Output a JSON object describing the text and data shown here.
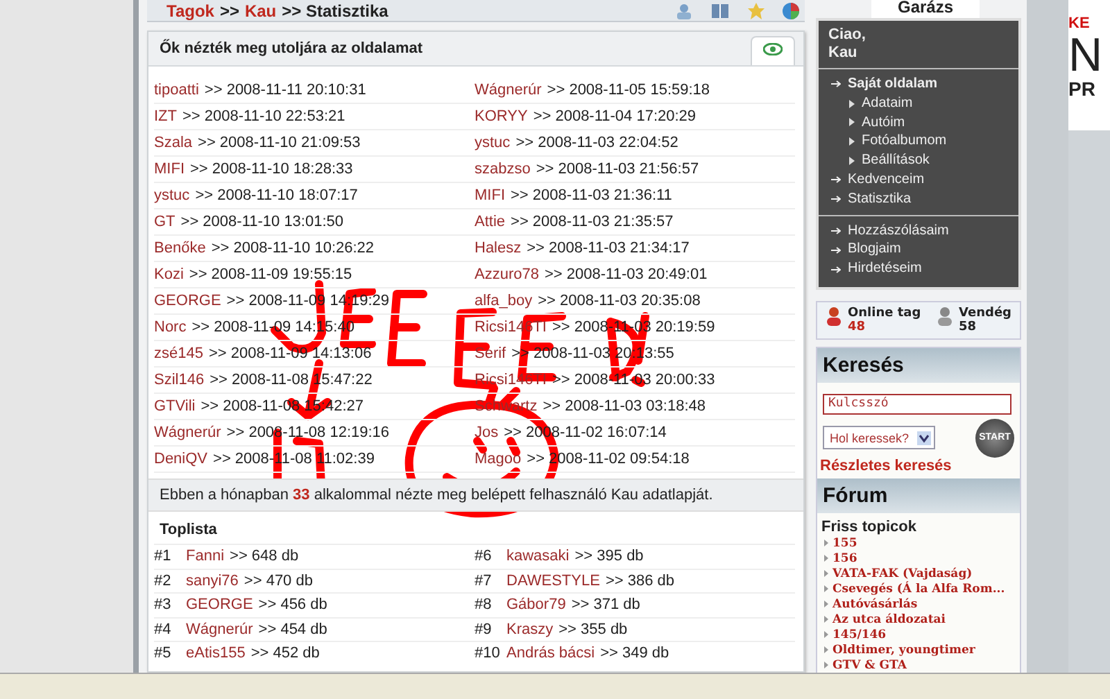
{
  "breadcrumb": [
    {
      "label": "Tagok",
      "kind": "link"
    },
    {
      "label": ">>",
      "kind": "text"
    },
    {
      "label": "Kau",
      "kind": "link"
    },
    {
      "label": ">> Statisztika",
      "kind": "text"
    }
  ],
  "visitors": {
    "title": "Ők nézték meg utoljára az oldalamat",
    "left": [
      {
        "name": "tipoatti",
        "time": ">> 2008-11-11 20:10:31"
      },
      {
        "name": "IZT",
        "time": ">> 2008-11-10 22:53:21"
      },
      {
        "name": "Szala",
        "time": ">> 2008-11-10 21:09:53"
      },
      {
        "name": "MIFI",
        "time": ">> 2008-11-10 18:28:33"
      },
      {
        "name": "ystuc",
        "time": ">> 2008-11-10 18:07:17"
      },
      {
        "name": "GT",
        "time": ">> 2008-11-10 13:01:50"
      },
      {
        "name": "Benőke",
        "time": ">> 2008-11-10 10:26:22"
      },
      {
        "name": "Kozi",
        "time": ">> 2008-11-09 19:55:15"
      },
      {
        "name": "GEORGE",
        "time": ">> 2008-11-09 14:19:29"
      },
      {
        "name": "Norc",
        "time": ">> 2008-11-09 14:15:40"
      },
      {
        "name": "zsé145",
        "time": ">> 2008-11-09 14:13:06"
      },
      {
        "name": "Szil146",
        "time": ">> 2008-11-08 15:47:22"
      },
      {
        "name": "GTVili",
        "time": ">> 2008-11-08 15:42:27"
      },
      {
        "name": "Wágnerúr",
        "time": ">> 2008-11-08 12:19:16"
      },
      {
        "name": "DeniQV",
        "time": ">> 2008-11-08 11:02:39"
      }
    ],
    "right": [
      {
        "name": "Wágnerúr",
        "time": ">> 2008-11-05 15:59:18"
      },
      {
        "name": "KORYY",
        "time": ">> 2008-11-04 17:20:29"
      },
      {
        "name": "ystuc",
        "time": ">> 2008-11-03 22:04:52"
      },
      {
        "name": "szabzso",
        "time": ">> 2008-11-03 21:56:57"
      },
      {
        "name": "MIFI",
        "time": ">> 2008-11-03 21:36:11"
      },
      {
        "name": "Attie",
        "time": ">> 2008-11-03 21:35:57"
      },
      {
        "name": "Halesz",
        "time": ">> 2008-11-03 21:34:17"
      },
      {
        "name": "Azzuro78",
        "time": ">> 2008-11-03 20:49:01"
      },
      {
        "name": "alfa_boy",
        "time": ">> 2008-11-03 20:35:08"
      },
      {
        "name": "Ricsi146TI",
        "time": ">> 2008-11-03 20:19:59"
      },
      {
        "name": "Serif",
        "time": ">> 2008-11-03 20:13:55"
      },
      {
        "name": "Ricsi146TI",
        "time": ">> 2008-11-03 20:00:33"
      },
      {
        "name": "Schwartz",
        "time": ">> 2008-11-03 03:18:48"
      },
      {
        "name": "Jos",
        "time": ">> 2008-11-02 16:07:14"
      },
      {
        "name": "Magoo",
        "time": ">> 2008-11-02 09:54:18"
      }
    ],
    "summary": {
      "before": "Ebben a hónapban",
      "count": "33",
      "after": "alkalommal nézte meg belépett felhasználó Kau adatlapját."
    }
  },
  "toplist": {
    "title": "Toplista",
    "items": [
      {
        "rank": "#1",
        "name": "Fanni",
        "count": ">> 648 db"
      },
      {
        "rank": "#2",
        "name": "sanyi76",
        "count": ">> 470 db"
      },
      {
        "rank": "#3",
        "name": "GEORGE",
        "count": ">> 456 db"
      },
      {
        "rank": "#4",
        "name": "Wágnerúr",
        "count": ">> 454 db"
      },
      {
        "rank": "#5",
        "name": "eAtis155",
        "count": ">> 452 db"
      },
      {
        "rank": "#6",
        "name": "kawasaki",
        "count": ">> 395 db"
      },
      {
        "rank": "#7",
        "name": "DAWESTYLE",
        "count": ">> 386 db"
      },
      {
        "rank": "#8",
        "name": "Gábor79",
        "count": ">> 371 db"
      },
      {
        "rank": "#9",
        "name": "Kraszy",
        "count": ">> 355 db"
      },
      {
        "rank": "#10",
        "name": "András bácsi",
        "count": ">> 349 db"
      }
    ]
  },
  "sidebar": {
    "tab": "Garázs",
    "greeting": "Ciao,",
    "user": "Kau",
    "menu": [
      {
        "label": "Saját oldalam",
        "kind": "main",
        "bold": true,
        "children": [
          {
            "label": "Adataim"
          },
          {
            "label": "Autóim"
          },
          {
            "label": "Fotóalbumom"
          },
          {
            "label": "Beállítások"
          }
        ]
      },
      {
        "label": "Kedvenceim",
        "kind": "main",
        "bold": false
      },
      {
        "label": "Statisztika",
        "kind": "main",
        "bold": false
      },
      {
        "label": "Hozzászólásaim",
        "kind": "divided",
        "bold": false
      },
      {
        "label": "Blogjaim",
        "kind": "main",
        "bold": false
      },
      {
        "label": "Hirdetéseim",
        "kind": "main",
        "bold": false
      }
    ],
    "online": {
      "label": "Online tag",
      "count": "48"
    },
    "guests": {
      "label": "Vendég",
      "count": "58"
    },
    "search": {
      "title": "Keresés",
      "placeholder": "Kulcsszó",
      "select": "Hol keressek?",
      "button": "START",
      "link": "Részletes keresés"
    },
    "forum": {
      "title": "Fórum",
      "subtitle": "Friss topicok",
      "topics": [
        "155",
        "156",
        "VATA-FAK (Vajdaság)",
        "Csevegés (Á la Alfa Rom...",
        "Autóvásárlás",
        "Az utca áldozatai",
        "145/146",
        "Oldtimer, youngtimer",
        "GTV & GTA"
      ]
    }
  },
  "ad": [
    "KE",
    "N",
    "PR"
  ]
}
